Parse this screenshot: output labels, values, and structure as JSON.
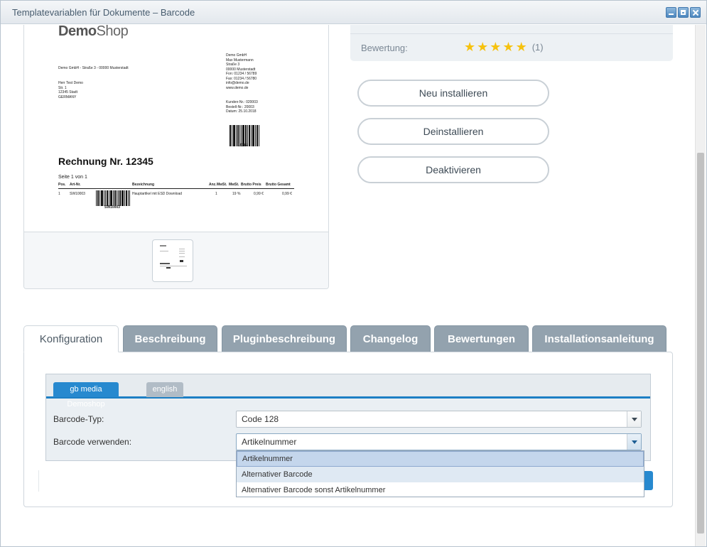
{
  "window": {
    "title": "Templatevariablen für Dokumente – Barcode"
  },
  "preview": {
    "logo_bold": "Demo",
    "logo_regular": "Shop",
    "sender_line": "Demo GmbH - Straße 3 - 00000 Musterstadt",
    "recipient": "Herr Test Demo\nStr. 1\n12345 Stadt\nGERMANY",
    "company_block": "Demo GmbH\nMax Mustermann\nStraße 3\n00000 Musterstadt\nFon: 01234 / 56789\nFax: 01234 / 56780\ninfo@demo.de\nwww.demo.de",
    "order_block": "Kunden-Nr.: 020003\nBestell-Nr.: 20003\nDatum: 25.10.2018",
    "barcode_top_label": "12345",
    "invoice_title": "Rechnung Nr. 12345",
    "page_info": "Seite 1 von 1",
    "table_headers": [
      "Pos.",
      "Art-Nr.",
      "Bezeichnung",
      "Anz.",
      "MwSt.",
      "MwSt.",
      "Brutto Preis",
      "Brutto Gesamt"
    ],
    "table_row": [
      "1",
      "SW10003",
      "Hauptartikel mit ESD Download",
      "1",
      "19 %",
      "0,99 €",
      "0,99 €"
    ],
    "barcode_row_label": "SW10003"
  },
  "info": {
    "rating_label": "Bewertung:",
    "rating_stars": 5,
    "rating_count": "(1)"
  },
  "actions": {
    "reinstall": "Neu installieren",
    "uninstall": "Deinstallieren",
    "deactivate": "Deaktivieren"
  },
  "tabs": {
    "konfiguration": "Konfiguration",
    "beschreibung": "Beschreibung",
    "pluginbeschreibung": "Pluginbeschreibung",
    "changelog": "Changelog",
    "bewertungen": "Bewertungen",
    "installationsanleitung": "Installationsanleitung"
  },
  "config": {
    "shop_tab": "gb media Demoshop",
    "lang_tab": "english",
    "barcode_type_label": "Barcode-Typ:",
    "barcode_type_value": "Code 128",
    "barcode_use_label": "Barcode verwenden:",
    "barcode_use_value": "Artikelnummer",
    "options": [
      "Artikelnummer",
      "Alternativer Barcode",
      "Alternativer Barcode sonst Artikelnummer"
    ]
  },
  "colors": {
    "accent": "#2789cf",
    "tab_inactive": "#93a2ae",
    "star": "#f6c20f"
  }
}
